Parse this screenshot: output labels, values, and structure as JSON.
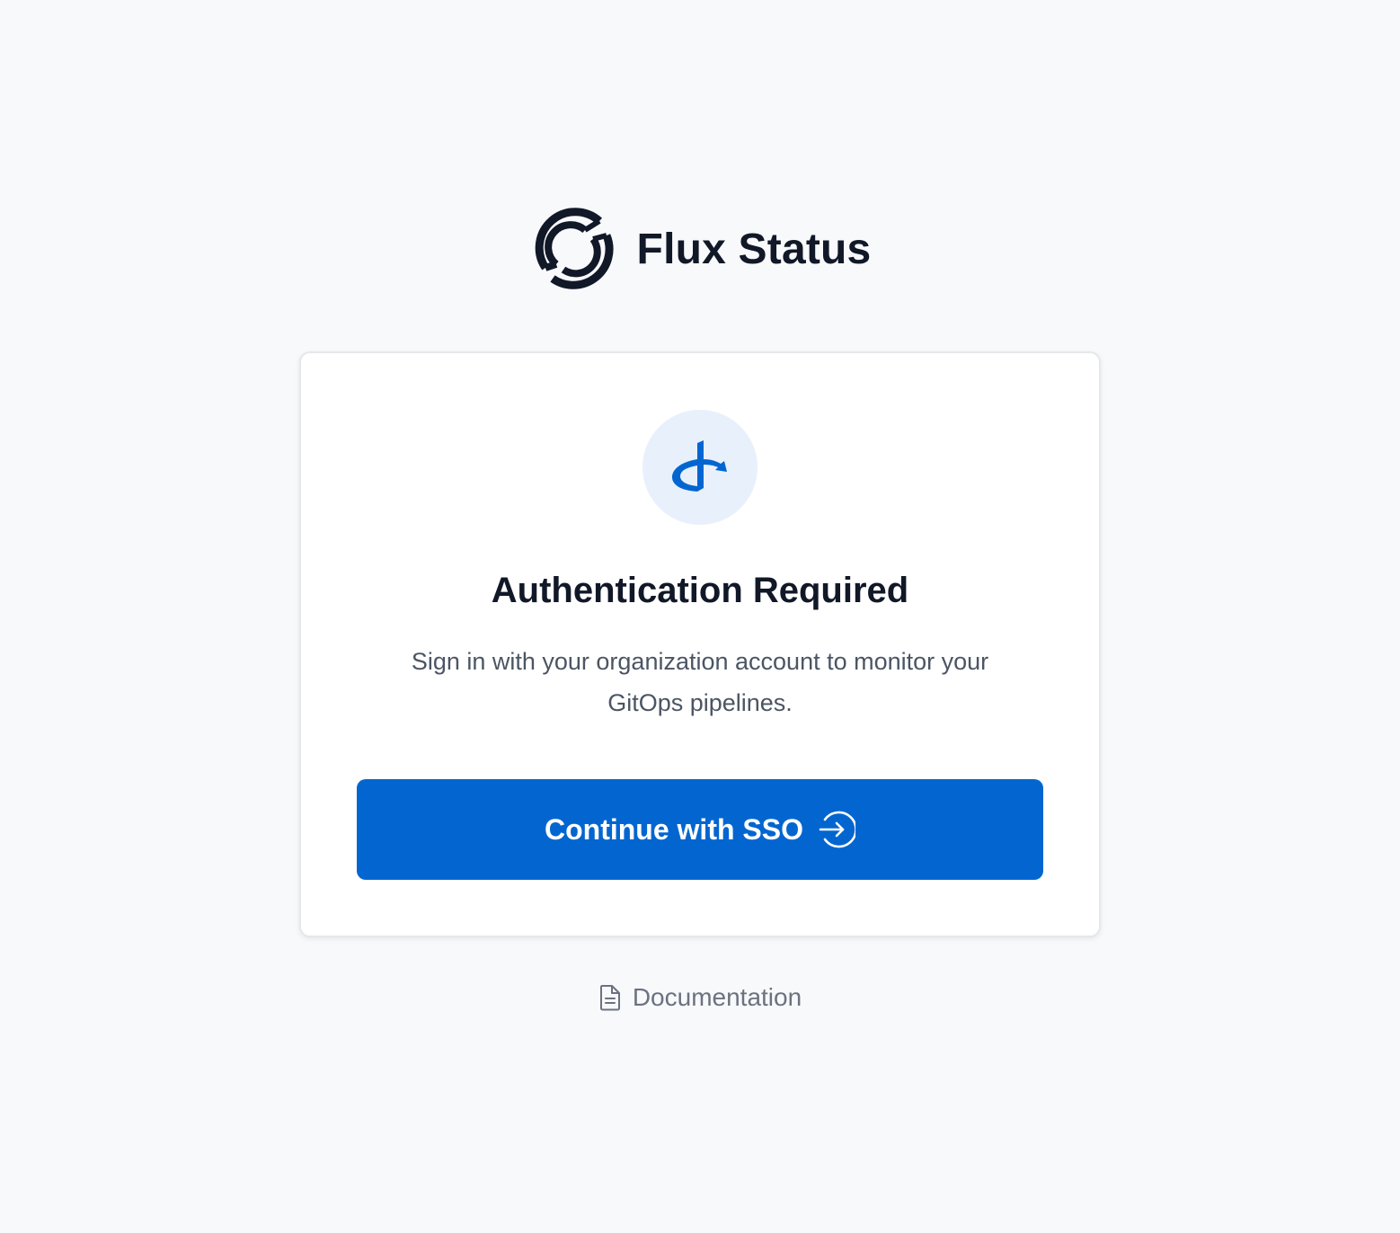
{
  "brand": {
    "title": "Flux Status",
    "logo_icon": "flux-sync-logo",
    "color": "#111827"
  },
  "card": {
    "provider_icon": "openid-icon",
    "title": "Authentication Required",
    "description": "Sign in with your organization account to monitor your GitOps pipelines.",
    "button": {
      "label": "Continue with SSO",
      "icon": "sign-in-arrow-icon",
      "color": "#0366d0"
    }
  },
  "footer": {
    "documentation_label": "Documentation",
    "documentation_icon": "document-icon"
  }
}
